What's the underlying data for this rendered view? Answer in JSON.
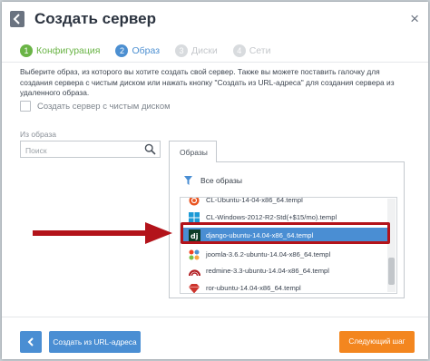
{
  "dialog": {
    "title": "Создать сервер",
    "close_glyph": "×"
  },
  "steps": [
    {
      "num": "1",
      "label": "Конфигурация",
      "state": "done"
    },
    {
      "num": "2",
      "label": "Образ",
      "state": "active"
    },
    {
      "num": "3",
      "label": "Диски",
      "state": "todo"
    },
    {
      "num": "4",
      "label": "Сети",
      "state": "todo"
    }
  ],
  "description": "Выберите образ, из которого вы хотите создать свой сервер. Также вы можете поставить галочку для создания сервера с чистым диском или нажать кнопку \"Создать из URL-адреса\" для создания сервера из удаленного образа.",
  "clean_disk_checkbox": {
    "label": "Создать сервер с чистым диском",
    "checked": false
  },
  "from_image_label": "Из образа",
  "search": {
    "placeholder": "Поиск",
    "value": ""
  },
  "tab_label": "Образы",
  "filter_label": "Все образы",
  "images": [
    {
      "name": "CL-Ubuntu-14-04-x86_64.templ",
      "icon": "ubuntu-icon"
    },
    {
      "name": "CL-Windows-2012-R2-Std(+$15/mo).templ",
      "icon": "windows-icon"
    },
    {
      "name": "django-ubuntu-14.04-x86_64.templ",
      "icon": "django-icon",
      "selected": true
    },
    {
      "name": "joomla-3.6.2-ubuntu-14.04-x86_64.templ",
      "icon": "joomla-icon"
    },
    {
      "name": "redmine-3.3-ubuntu-14.04-x86_64.templ",
      "icon": "redmine-icon"
    },
    {
      "name": "ror-ubuntu-14.04-x86_64.templ",
      "icon": "ruby-icon"
    }
  ],
  "footer": {
    "url_button": "Создать из URL-адреса",
    "next_button": "Следующий шаг"
  },
  "colors": {
    "accent_blue": "#4a8ed3",
    "step_done_green": "#6ab446",
    "next_orange": "#f3861f",
    "highlight_red": "#b3131a"
  }
}
